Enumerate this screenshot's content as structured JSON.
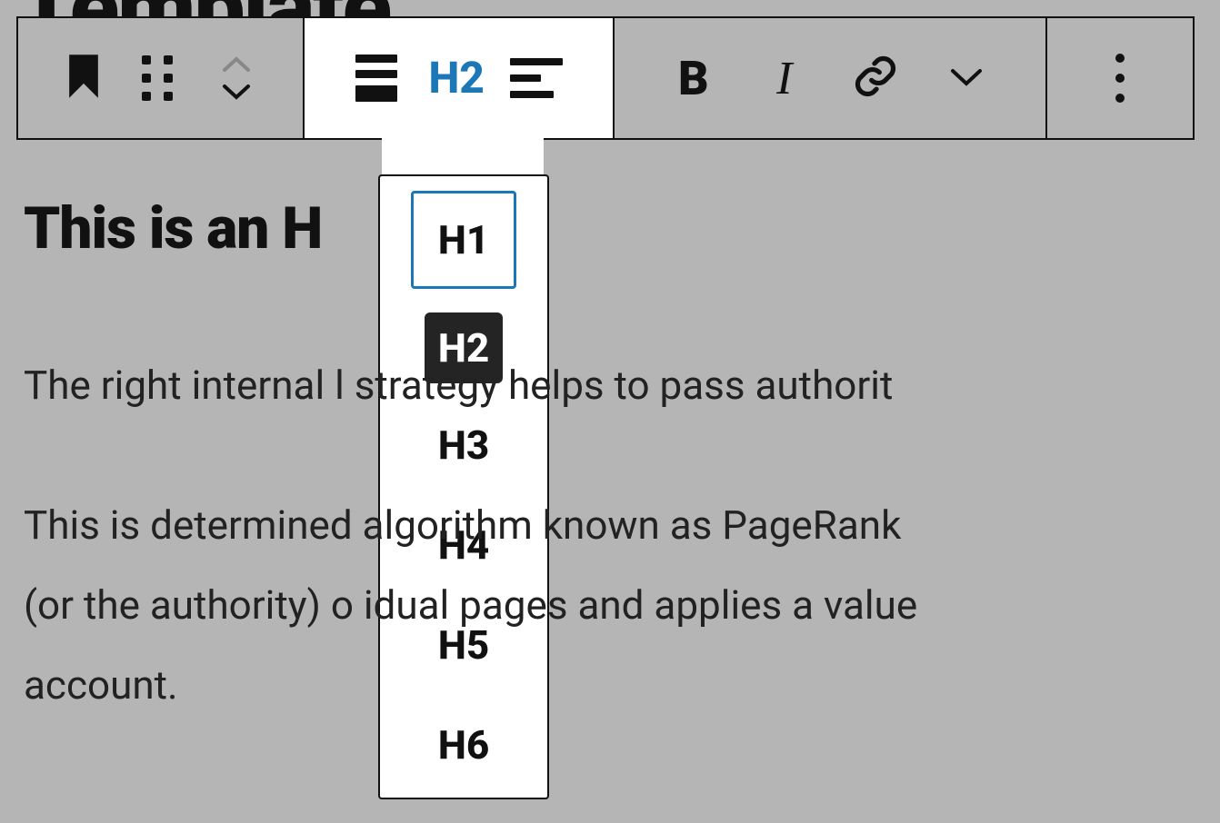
{
  "partial_title": "Template",
  "toolbar": {
    "active_heading": "H2",
    "bold_label": "B",
    "italic_label": "I"
  },
  "heading_options": [
    "H1",
    "H2",
    "H3",
    "H4",
    "H5",
    "H6"
  ],
  "selected_heading": "H2",
  "focused_heading": "H1",
  "document": {
    "heading_text": "This is an H",
    "paragraph1": "The right internal l          strategy helps to pass authorit",
    "paragraph2": "This is determined           algorithm known as PageRank\n(or the authority) o         idual pages and applies a value\naccount."
  },
  "colors": {
    "accent": "#1b77b6",
    "toolbar_bg": "#b5b5b5",
    "border": "#111111"
  }
}
